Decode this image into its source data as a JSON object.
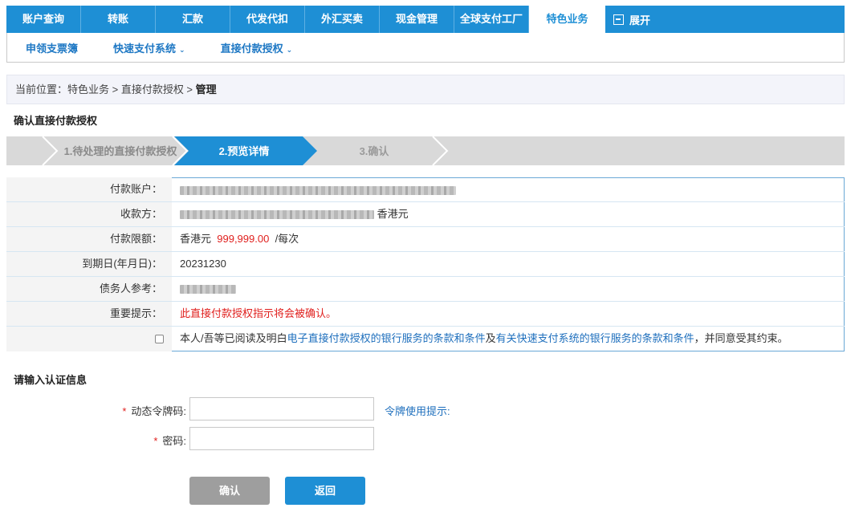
{
  "topnav": {
    "tabs": [
      {
        "label": "账户查询",
        "active": false
      },
      {
        "label": "转账",
        "active": false
      },
      {
        "label": "汇款",
        "active": false
      },
      {
        "label": "代发代扣",
        "active": false
      },
      {
        "label": "外汇买卖",
        "active": false
      },
      {
        "label": "现金管理",
        "active": false
      },
      {
        "label": "全球支付工厂",
        "active": false
      },
      {
        "label": "特色业务",
        "active": true
      }
    ],
    "expand_label": "展开"
  },
  "subnav": {
    "items": [
      {
        "label": "申领支票簿"
      },
      {
        "label": "快速支付系统",
        "has_dropdown": true
      },
      {
        "label": "直接付款授权",
        "has_dropdown": true
      }
    ]
  },
  "breadcrumb": {
    "prefix": "当前位置：特色业务 > 直接付款授权 > ",
    "current": "管理"
  },
  "page_title": "确认直接付款授权",
  "steps": [
    {
      "label": "1.待处理的直接付款授权",
      "state": "done"
    },
    {
      "label": "2.预览详情",
      "state": "active"
    },
    {
      "label": "3.确认",
      "state": "pending"
    }
  ],
  "details": {
    "payer_account_label": "付款账户：",
    "payee_label": "收款方：",
    "payee_currency": "香港元",
    "limit_label": "付款限额：",
    "limit_currency": "香港元",
    "limit_amount": "999,999.00",
    "limit_unit": "/每次",
    "expiry_label": "到期日(年月日)：",
    "expiry_value": "20231230",
    "debtor_ref_label": "债务人参考：",
    "notice_label": "重要提示：",
    "notice_text": "此直接付款授权指示将会被确认。",
    "agree_prefix": "本人/吾等已阅读及明白",
    "agree_link1": "电子直接付款授权的银行服务的条款和条件",
    "agree_mid": "及",
    "agree_link2": "有关快速支付系统的银行服务的条款和条件",
    "agree_suffix": "，并同意受其约束。"
  },
  "auth": {
    "title": "请输入认证信息",
    "token_label": "动态令牌码:",
    "token_hint": "令牌使用提示:",
    "password_label": "密码:",
    "required_mark": "*"
  },
  "buttons": {
    "confirm": "确认",
    "back": "返回"
  },
  "colors": {
    "brand_blue": "#1e8fd5",
    "link_blue": "#1e6fbd",
    "alert_red": "#e0201e",
    "step_gray": "#d9d9d9"
  }
}
